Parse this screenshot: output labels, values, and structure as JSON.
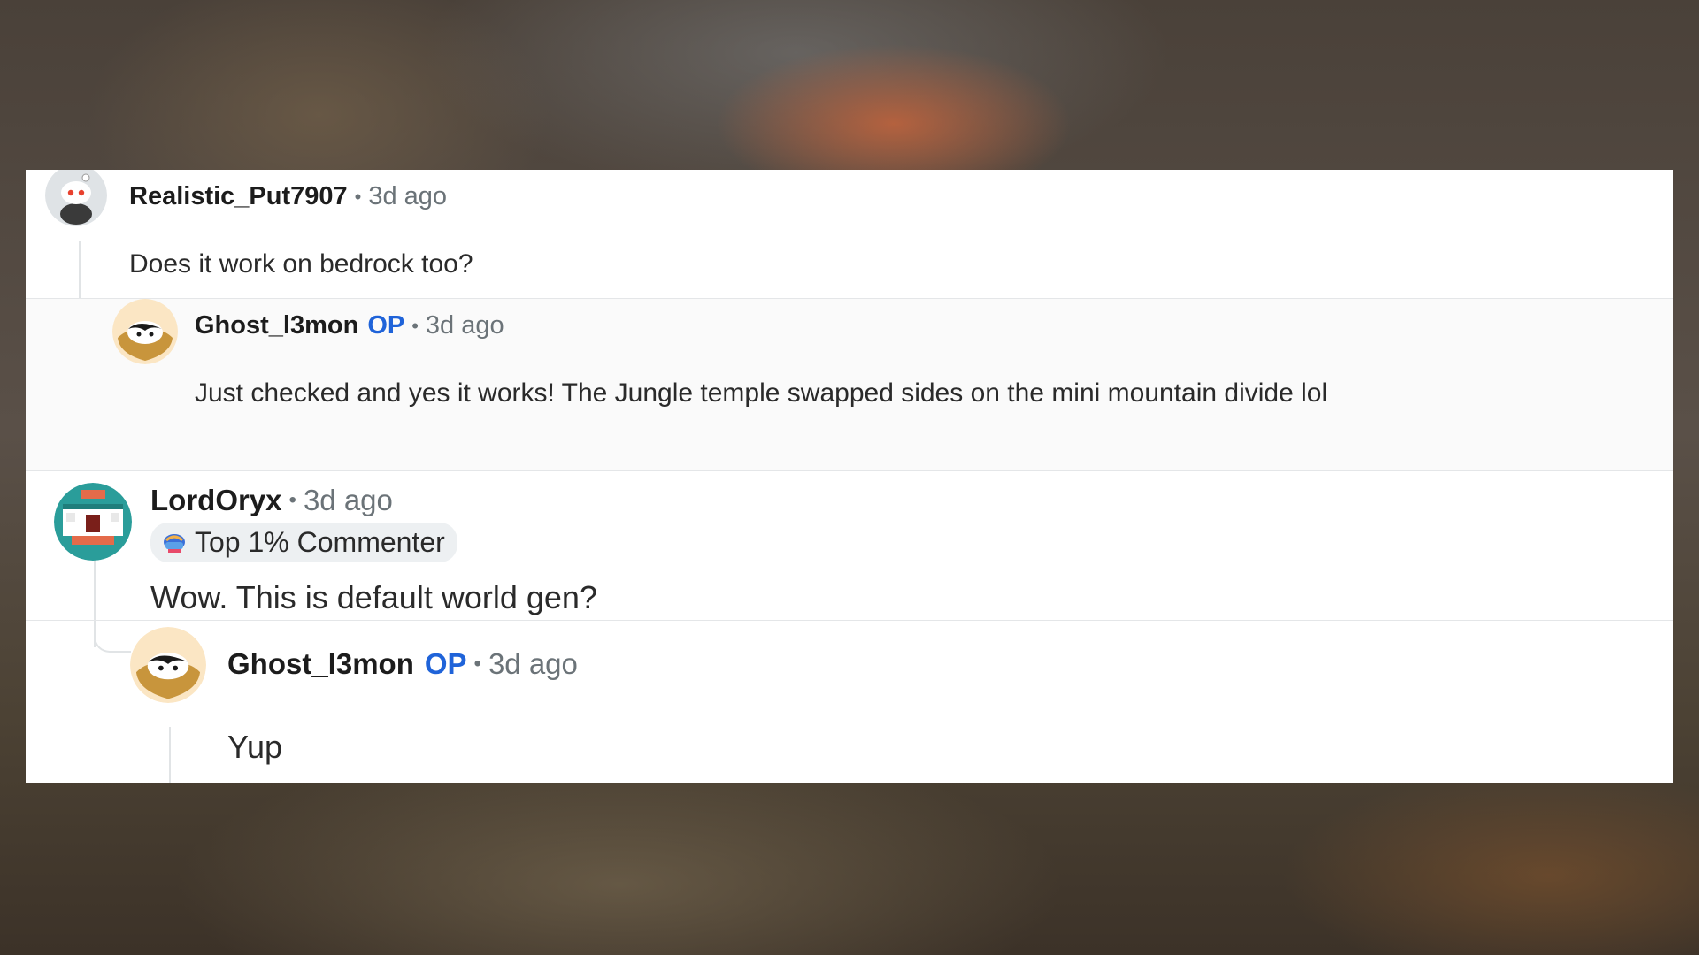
{
  "comments": [
    {
      "author": "Realistic_Put7907",
      "op_badge": "",
      "time": "3d ago",
      "separator": "•",
      "body": "Does it work on bedrock too?",
      "avatar_icon": "snoo-avatar-icon"
    },
    {
      "author": "Ghost_l3mon",
      "op_badge": "OP",
      "time": "3d ago",
      "separator": "•",
      "body": "Just checked and yes it works! The Jungle temple swapped sides on the mini mountain divide lol",
      "avatar_icon": "ghost-avatar-icon"
    },
    {
      "author": "LordOryx",
      "op_badge": "",
      "time": "3d ago",
      "separator": "•",
      "flair": "Top 1% Commenter",
      "body": "Wow. This is default world gen?",
      "avatar_icon": "pixel-avatar-icon"
    },
    {
      "author": "Ghost_l3mon",
      "op_badge": "OP",
      "time": "3d ago",
      "separator": "•",
      "body": "Yup",
      "avatar_icon": "ghost-avatar-icon"
    }
  ],
  "colors": {
    "op": "#1f63d9",
    "muted": "#6b7378",
    "author": "#1c1c1c",
    "card": "#ffffff"
  }
}
